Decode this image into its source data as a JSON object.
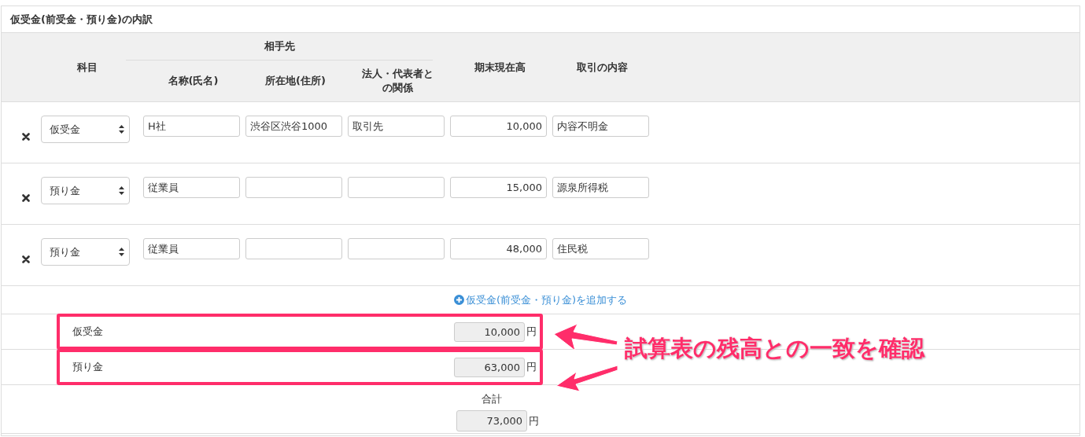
{
  "panel": {
    "title": "仮受金(前受金・預り金)の内訳"
  },
  "table": {
    "columns": {
      "account": "科目",
      "counterparty": "相手先",
      "name": "名称(氏名)",
      "address": "所在地(住所)",
      "relation": "法人・代表者との関係",
      "balance": "期末現在高",
      "details": "取引の内容"
    },
    "rows": [
      {
        "account": "仮受金",
        "name": "H社",
        "address": "渋谷区渋谷1000",
        "relation": "取引先",
        "balance": "10,000",
        "details": "内容不明金"
      },
      {
        "account": "預り金",
        "name": "従業員",
        "balance": "15,000",
        "details": "源泉所得税"
      },
      {
        "account": "預り金",
        "name": "従業員",
        "balance": "48,000",
        "details": "住民税"
      }
    ]
  },
  "add_link": "仮受金(前受金・預り金)を追加する",
  "summary": [
    {
      "label": "仮受金",
      "amount": "10,000",
      "unit": "円",
      "highlighted": true
    },
    {
      "label": "預り金",
      "amount": "63,000",
      "unit": "円",
      "highlighted": true
    }
  ],
  "total": {
    "label": "合計",
    "amount": "73,000",
    "unit": "円"
  },
  "annotation": {
    "text": "試算表の残高との一致を確認"
  }
}
